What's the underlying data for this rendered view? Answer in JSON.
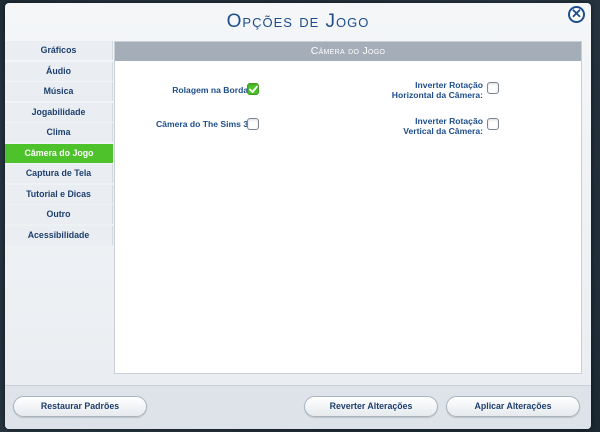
{
  "dialog": {
    "title": "Opções de Jogo",
    "close_label": "✕"
  },
  "sidebar": {
    "items": [
      {
        "label": "Gráficos"
      },
      {
        "label": "Áudio"
      },
      {
        "label": "Música"
      },
      {
        "label": "Jogabilidade"
      },
      {
        "label": "Clima"
      },
      {
        "label": "Câmera do Jogo",
        "active": true
      },
      {
        "label": "Captura de Tela"
      },
      {
        "label": "Tutorial e Dicas"
      },
      {
        "label": "Outro"
      },
      {
        "label": "Acessibilidade"
      }
    ]
  },
  "panel": {
    "header": "Câmera do Jogo",
    "options": {
      "edge_scroll": {
        "label": "Rolagem na Borda:",
        "checked": true
      },
      "sims3_camera": {
        "label": "Câmera do The Sims 3:",
        "checked": false
      },
      "invert_horizontal": {
        "line1": "Inverter Rotação",
        "line2": "Horizontal da Câmera:",
        "checked": false
      },
      "invert_vertical": {
        "line1": "Inverter Rotação",
        "line2": "Vertical da Câmera:",
        "checked": false
      }
    }
  },
  "footer": {
    "restore_defaults": "Restaurar Padrões",
    "revert_changes": "Reverter Alterações",
    "apply_changes": "Aplicar Alterações"
  },
  "colors": {
    "accent_green": "#4ec22a",
    "title_blue": "#1e4e8c",
    "header_gray": "#a4adb8"
  }
}
